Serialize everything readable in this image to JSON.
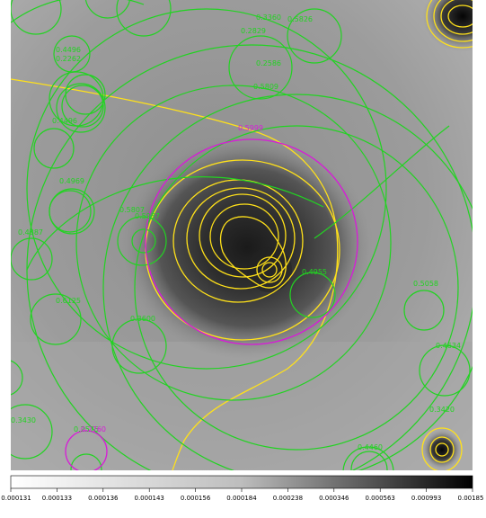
{
  "image": {
    "description_colors": {
      "overlay_green": "#22d322",
      "overlay_yellow": "#ffe11a",
      "overlay_magenta": "#d81ad8"
    }
  },
  "region_labels": {
    "g1": "0.4496",
    "g2": "0.2262",
    "g3": "0.3360",
    "g4": "0.5826",
    "g5": "0.2829",
    "g6": "0.2586",
    "g7": "0.5809",
    "g8": "0.4969",
    "g9": "0.5807",
    "g10": "0.5937",
    "g11": "0.4887",
    "g12": "0.4955",
    "g13": "0.6125",
    "g14": "0.3600",
    "g15": "0.5058",
    "g16": "0.4634",
    "g17": "0.3430",
    "g18": "0.2575",
    "g19": "0.3420",
    "g20": "0.4460",
    "m1": "0.5999",
    "m2": "0.2760"
  },
  "colorbar": {
    "ticks": [
      "0.000131",
      "0.000133",
      "0.000136",
      "0.000143",
      "0.000156",
      "0.000184",
      "0.000238",
      "0.000346",
      "0.000563",
      "0.000993",
      "0.00185"
    ]
  }
}
